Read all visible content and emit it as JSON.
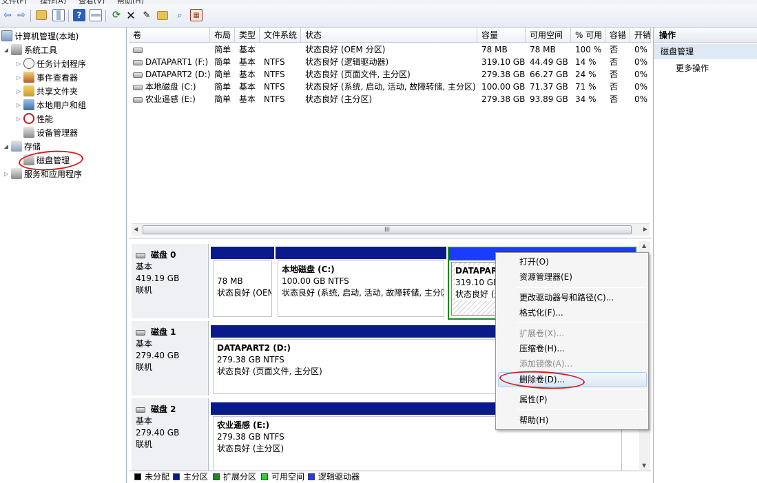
{
  "menubar": [
    "文件(F)",
    "操作(A)",
    "查看(V)",
    "帮助(H)"
  ],
  "toolbar": {
    "icons": [
      "back-icon",
      "forward-icon",
      "up-folder-icon",
      "show-hide-tree-icon",
      "help-icon",
      "properties-pane-icon",
      "refresh-icon",
      "delete-icon",
      "properties-icon",
      "open-folder-icon",
      "search-icon",
      "export-icon"
    ]
  },
  "tree": {
    "root": "计算机管理(本地)",
    "system_tools": "系统工具",
    "task_scheduler": "任务计划程序",
    "event_viewer": "事件查看器",
    "shared_folders": "共享文件夹",
    "local_users": "本地用户和组",
    "performance": "性能",
    "device_manager": "设备管理器",
    "storage": "存储",
    "disk_management": "磁盘管理",
    "services_apps": "服务和应用程序"
  },
  "list": {
    "headers": [
      "卷",
      "布局",
      "类型",
      "文件系统",
      "状态",
      "容量",
      "可用空间",
      "% 可用",
      "容错",
      "开销"
    ],
    "rows": [
      [
        "",
        "简单",
        "基本",
        "",
        "状态良好 (OEM 分区)",
        "78 MB",
        "78 MB",
        "100 %",
        "否",
        "0%"
      ],
      [
        "DATAPART1 (F:)",
        "简单",
        "基本",
        "NTFS",
        "状态良好 (逻辑驱动器)",
        "319.10 GB",
        "44.49 GB",
        "14 %",
        "否",
        "0%"
      ],
      [
        "DATAPART2 (D:)",
        "简单",
        "基本",
        "NTFS",
        "状态良好 (页面文件, 主分区)",
        "279.38 GB",
        "66.27 GB",
        "24 %",
        "否",
        "0%"
      ],
      [
        "本地磁盘 (C:)",
        "简单",
        "基本",
        "NTFS",
        "状态良好 (系统, 启动, 活动, 故障转储, 主分区)",
        "100.00 GB",
        "71.37 GB",
        "71 %",
        "否",
        "0%"
      ],
      [
        "农业遥感 (E:)",
        "简单",
        "基本",
        "NTFS",
        "状态良好 (主分区)",
        "279.38 GB",
        "93.89 GB",
        "34 %",
        "否",
        "0%"
      ]
    ],
    "scroll_grip": "III"
  },
  "disks": [
    {
      "name": "磁盘 0",
      "type": "基本",
      "size": "419.19 GB",
      "status": "联机",
      "partitions": [
        {
          "title": "",
          "size": "78 MB",
          "status": "状态良好 (OEM"
        },
        {
          "title": "本地磁盘  (C:)",
          "size": "100.00 GB NTFS",
          "status": "状态良好 (系统, 启动, 活动, 故障转储, 主分区"
        },
        {
          "title": "DATAPAR",
          "size": "319.10 GB",
          "status": "状态良好 (逻"
        }
      ]
    },
    {
      "name": "磁盘 1",
      "type": "基本",
      "size": "279.40 GB",
      "status": "联机",
      "partitions": [
        {
          "title": "DATAPART2  (D:)",
          "size": "279.38 GB NTFS",
          "status": "状态良好 (页面文件, 主分区)"
        }
      ]
    },
    {
      "name": "磁盘 2",
      "type": "基本",
      "size": "279.40 GB",
      "status": "联机",
      "partitions": [
        {
          "title": "农业遥感  (E:)",
          "size": "279.38 GB NTFS",
          "status": "状态良好 (主分区)"
        }
      ]
    }
  ],
  "legend": [
    {
      "label": "未分配",
      "color": "#000000"
    },
    {
      "label": "主分区",
      "color": "#0a1a8c"
    },
    {
      "label": "扩展分区",
      "color": "#1a8a1a"
    },
    {
      "label": "可用空间",
      "color": "#33cc33"
    },
    {
      "label": "逻辑驱动器",
      "color": "#1a3cff"
    }
  ],
  "actions": {
    "header": "操作",
    "selected": "磁盘管理",
    "more": "更多操作"
  },
  "context_menu": {
    "open": "打开(O)",
    "explorer": "资源管理器(E)",
    "change_letter": "更改驱动器号和路径(C)...",
    "format": "格式化(F)...",
    "extend": "扩展卷(X)...",
    "shrink": "压缩卷(H)...",
    "mirror": "添加镜像(A)...",
    "delete": "删除卷(D)...",
    "properties": "属性(P)",
    "help": "帮助(H)"
  }
}
